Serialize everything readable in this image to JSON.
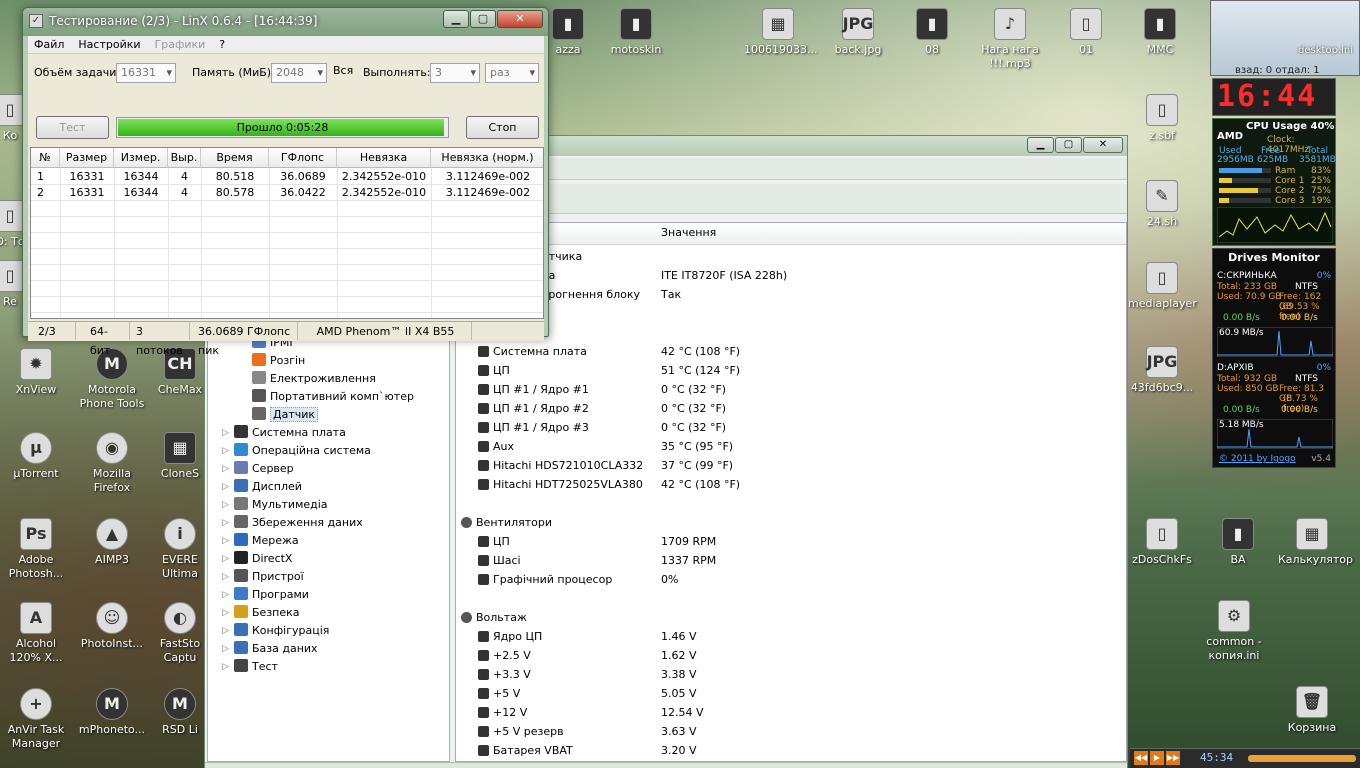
{
  "desktop_icons": [
    {
      "label": "azza",
      "glyph": "▮",
      "style": "dark"
    },
    {
      "label": "motoskin",
      "glyph": "▮",
      "style": "dark"
    },
    {
      "label": "100619033...",
      "glyph": "▦",
      "style": ""
    },
    {
      "label": "back.jpg",
      "glyph": "JPG",
      "style": ""
    },
    {
      "label": "08",
      "glyph": "▮",
      "style": "dark"
    },
    {
      "label": "Нага нага !!!.mp3",
      "glyph": "♪",
      "style": ""
    },
    {
      "label": "01",
      "glyph": "▯",
      "style": ""
    },
    {
      "label": "MMC",
      "glyph": "▮",
      "style": "dark"
    },
    {
      "label": "24.sh",
      "glyph": "✎",
      "style": ""
    },
    {
      "label": "mediaplayer",
      "glyph": "▯",
      "style": ""
    },
    {
      "label": "43fd6bc9...",
      "glyph": "JPG",
      "style": ""
    },
    {
      "label": "zDosChkFs",
      "glyph": "▯",
      "style": ""
    },
    {
      "label": "BA",
      "glyph": "▮",
      "style": "dark"
    },
    {
      "label": "Калькулятор",
      "glyph": "▦",
      "style": ""
    },
    {
      "label": "common - копия.ini",
      "glyph": "⚙",
      "style": ""
    },
    {
      "label": "Корзина",
      "glyph": "🗑",
      "style": ""
    },
    {
      "label": "XnView",
      "glyph": "✹",
      "style": ""
    },
    {
      "label": "Motorola Phone Tools",
      "glyph": "M",
      "style": "dark round"
    },
    {
      "label": "CheMax",
      "glyph": "CH",
      "style": "dark"
    },
    {
      "label": "µTorrent",
      "glyph": "µ",
      "style": "round"
    },
    {
      "label": "Mozilla Firefox",
      "glyph": "◉",
      "style": "round"
    },
    {
      "label": "CloneS",
      "glyph": "▦",
      "style": "dark"
    },
    {
      "label": "Adobe Photosh...",
      "glyph": "Ps",
      "style": ""
    },
    {
      "label": "AIMP3",
      "glyph": "▲",
      "style": "round"
    },
    {
      "label": "EVERE Ultima",
      "glyph": "i",
      "style": "round"
    },
    {
      "label": "Alcohol 120% X...",
      "glyph": "A",
      "style": ""
    },
    {
      "label": "PhotoInst...",
      "glyph": "☺",
      "style": "round"
    },
    {
      "label": "FastSto Captu",
      "glyph": "◐",
      "style": "round"
    },
    {
      "label": "AnVir Task Manager",
      "glyph": "+",
      "style": "round"
    },
    {
      "label": "mPhoneto...",
      "glyph": "M",
      "style": "dark round"
    },
    {
      "label": "RSD Li",
      "glyph": "M",
      "style": "dark round"
    },
    {
      "label": "Ко",
      "glyph": "▯",
      "style": ""
    },
    {
      "label": "D: То",
      "glyph": "▯",
      "style": ""
    },
    {
      "label": "Re",
      "glyph": "▯",
      "style": ""
    },
    {
      "label": "z.sbf",
      "glyph": "▯",
      "style": ""
    }
  ],
  "gadgets": {
    "top_text": "desktop.ini",
    "top_sub": "взад: 0 отдал: 1",
    "clock": "16:44",
    "cpu": {
      "title": "CPU Usage 40%",
      "brand": "AMD",
      "clock": "Clock: 4017MHz",
      "mem_hdr": [
        "Used",
        "Free",
        "Total"
      ],
      "mem_vals": [
        "2956MB",
        "625MB",
        "3581MB"
      ],
      "bars": [
        {
          "name": "Ram",
          "val": "83%",
          "pct": 83
        },
        {
          "name": "Core 1",
          "val": "25%",
          "pct": 25
        },
        {
          "name": "Core 2",
          "val": "75%",
          "pct": 75
        },
        {
          "name": "Core 3",
          "val": "19%",
          "pct": 19
        }
      ]
    },
    "drives": {
      "title": "Drives Monitor",
      "c": {
        "name": "C:СКРИНЬКА",
        "pct": "0%",
        "total": "Total: 233 GB",
        "fs": "NTFS",
        "used": "Used: 70.9 GB",
        "free": "Free: 162 GB",
        "freepct": "(69.53 % free)",
        "up": "0.00 B/s",
        "down": "0.00 B/s",
        "rate": "60.9 MB/s"
      },
      "d": {
        "name": "D:АРХІВ",
        "pct": "0%",
        "total": "Total: 932 GB",
        "fs": "NTFS",
        "used": "Used: 850 GB",
        "free": "Free: 81.3 GB",
        "freepct": "(8.73 % free)",
        "up": "0.00 B/s",
        "down": "0.00 B/s",
        "rate": "5.18 MB/s"
      },
      "footer": "© 2011 by Igogo",
      "version": "v5.4"
    },
    "bottom_time": "45:34"
  },
  "aida": {
    "header_col1": "Значення",
    "partial_top": [
      "атчика",
      "ка",
      "трогнення блоку"
    ],
    "partial_vals": [
      "ITE IT8720F  (ISA 228h)",
      "Так"
    ],
    "tree": [
      {
        "label": "IPMI",
        "indent": 2,
        "color": "#4a7fc4"
      },
      {
        "label": "Розгін",
        "indent": 2,
        "color": "#e87020"
      },
      {
        "label": "Електроживлення",
        "indent": 2,
        "color": "#888"
      },
      {
        "label": "Портативний комп`ютер",
        "indent": 2,
        "color": "#555"
      },
      {
        "label": "Датчик",
        "indent": 2,
        "color": "#666",
        "sel": true
      },
      {
        "label": "Системна плата",
        "indent": 1,
        "color": "#333",
        "tgl": true
      },
      {
        "label": "Операційна система",
        "indent": 1,
        "color": "#2d8bd6",
        "tgl": true
      },
      {
        "label": "Сервер",
        "indent": 1,
        "color": "#6b7ab0",
        "tgl": true
      },
      {
        "label": "Дисплей",
        "indent": 1,
        "color": "#3a6fb5",
        "tgl": true
      },
      {
        "label": "Мультимедіа",
        "indent": 1,
        "color": "#777",
        "tgl": true
      },
      {
        "label": "Збереження даних",
        "indent": 1,
        "color": "#666",
        "tgl": true
      },
      {
        "label": "Мережа",
        "indent": 1,
        "color": "#2b6cc0",
        "tgl": true
      },
      {
        "label": "DirectX",
        "indent": 1,
        "color": "#222",
        "tgl": true
      },
      {
        "label": "Пристрої",
        "indent": 1,
        "color": "#555",
        "tgl": true
      },
      {
        "label": "Програми",
        "indent": 1,
        "color": "#3c7bc9",
        "tgl": true
      },
      {
        "label": "Безпека",
        "indent": 1,
        "color": "#d4a017",
        "tgl": true
      },
      {
        "label": "Конфігурація",
        "indent": 1,
        "color": "#3a6fb5",
        "tgl": true
      },
      {
        "label": "База даних",
        "indent": 1,
        "color": "#3a6fb5",
        "tgl": true
      },
      {
        "label": "Тест",
        "indent": 1,
        "color": "#444",
        "tgl": true
      }
    ],
    "rows": [
      {
        "label": "Системна плата",
        "value": "42 °C  (108 °F)"
      },
      {
        "label": "ЦП",
        "value": "51 °C  (124 °F)"
      },
      {
        "label": "ЦП #1 / Ядро #1",
        "value": "0 °C  (32 °F)"
      },
      {
        "label": "ЦП #1 / Ядро #2",
        "value": "0 °C  (32 °F)"
      },
      {
        "label": "ЦП #1 / Ядро #3",
        "value": "0 °C  (32 °F)"
      },
      {
        "label": "Aux",
        "value": "35 °C  (95 °F)"
      },
      {
        "label": "Hitachi HDS721010CLA332",
        "value": "37 °C  (99 °F)"
      },
      {
        "label": "Hitachi HDT725025VLA380",
        "value": "42 °C  (108 °F)"
      },
      {
        "label": "Вентилятори",
        "value": "",
        "group": true
      },
      {
        "label": "ЦП",
        "value": "1709 RPM"
      },
      {
        "label": "Шасі",
        "value": "1337 RPM"
      },
      {
        "label": "Графічний процесор",
        "value": "0%"
      },
      {
        "label": "Вольтаж",
        "value": "",
        "group": true
      },
      {
        "label": "Ядро ЦП",
        "value": "1.46 V"
      },
      {
        "label": "+2.5 V",
        "value": "1.62 V"
      },
      {
        "label": "+3.3 V",
        "value": "3.38 V"
      },
      {
        "label": "+5 V",
        "value": "5.05 V"
      },
      {
        "label": "+12 V",
        "value": "12.54 V"
      },
      {
        "label": "+5 V резерв",
        "value": "3.63 V"
      },
      {
        "label": "Батарея VBAT",
        "value": "3.20 V"
      }
    ]
  },
  "linx": {
    "title": "Тестирование (2/3) - LinX 0.6.4 - [16:44:39]",
    "menu": [
      {
        "label": "Файл",
        "dis": false
      },
      {
        "label": "Настройки",
        "dis": false
      },
      {
        "label": "Графики",
        "dis": true
      },
      {
        "label": "?",
        "dis": false
      }
    ],
    "size_label": "Объём задачи:",
    "size_value": "16331",
    "mem_label": "Память (МиБ):",
    "mem_value": "2048",
    "all_label": "Вся",
    "run_label": "Выполнять:",
    "run_value": "3",
    "run_unit": "раз",
    "test_button": "Тест",
    "stop_button": "Стоп",
    "progress_text": "Прошло 0:05:28",
    "progress": 0.99,
    "columns": [
      "№",
      "Размер",
      "Измер.",
      "Выр.",
      "Время",
      "ГФлопс",
      "Невязка",
      "Невязка (норм.)"
    ],
    "rows": [
      [
        "1",
        "16331",
        "16344",
        "4",
        "80.518",
        "36.0689",
        "2.342552e-010",
        "3.112469e-002"
      ],
      [
        "2",
        "16331",
        "16344",
        "4",
        "80.578",
        "36.0422",
        "2.342552e-010",
        "3.112469e-002"
      ]
    ],
    "status": [
      "2/3",
      "64-бит",
      "3 потоков",
      "36.0689 ГФлопс пик",
      "AMD Phenom™ II X4 B55"
    ]
  }
}
